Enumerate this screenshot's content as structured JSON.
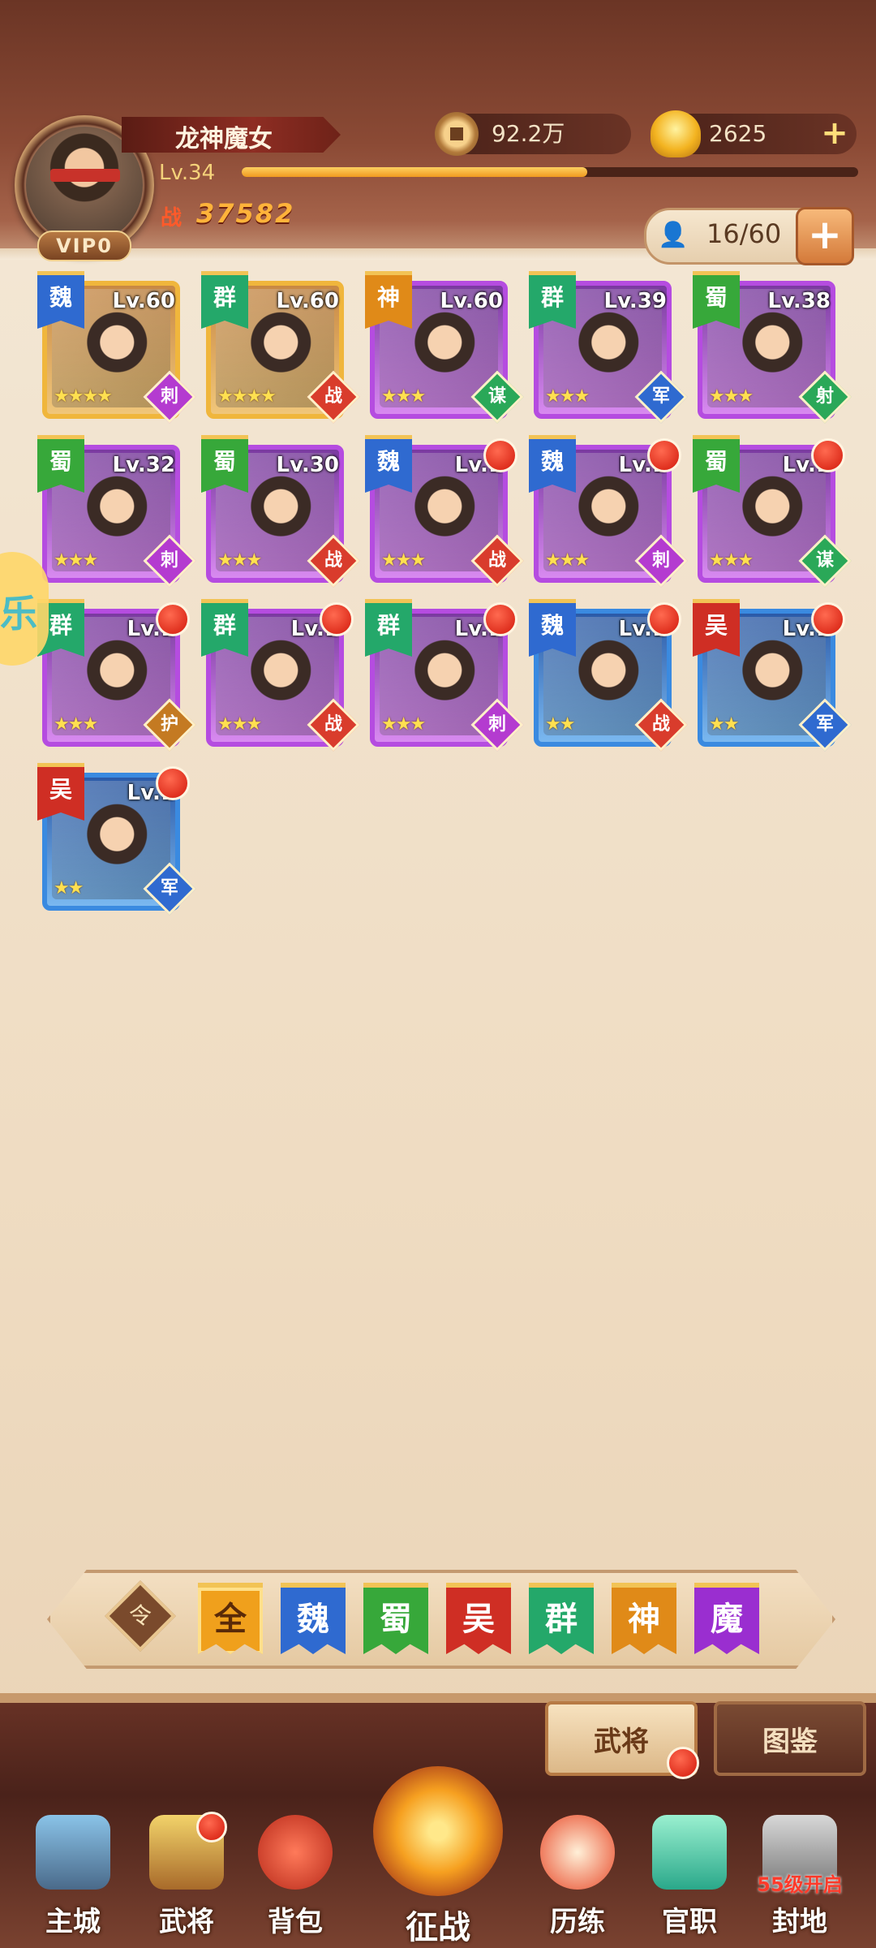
{
  "header": {
    "player_name": "龙神魔女",
    "level": "Lv.34",
    "xp_fraction": 0.56,
    "vip": "VIP0",
    "power": "37582",
    "power_icon": "战",
    "currency_coin": "92.2万",
    "currency_gold": "2625",
    "hero_capacity": "16/60"
  },
  "heroes": [
    {
      "faction": "魏",
      "level": "Lv.60",
      "stars": "★★★★",
      "role": "刺"
    },
    {
      "faction": "群",
      "level": "Lv.60",
      "stars": "★★★★",
      "role": "战"
    },
    {
      "faction": "神",
      "level": "Lv.60",
      "stars": "★★★",
      "role": "谋"
    },
    {
      "faction": "群",
      "level": "Lv.39",
      "stars": "★★★",
      "role": "军"
    },
    {
      "faction": "蜀",
      "level": "Lv.38",
      "stars": "★★★",
      "role": "射"
    },
    {
      "faction": "蜀",
      "level": "Lv.32",
      "stars": "★★★",
      "role": "刺"
    },
    {
      "faction": "蜀",
      "level": "Lv.30",
      "stars": "★★★",
      "role": "战"
    },
    {
      "faction": "魏",
      "level": "Lv.1",
      "stars": "★★★",
      "role": "战"
    },
    {
      "faction": "魏",
      "level": "Lv.1",
      "stars": "★★★",
      "role": "刺"
    },
    {
      "faction": "蜀",
      "level": "Lv.1",
      "stars": "★★★",
      "role": "谋"
    },
    {
      "faction": "群",
      "level": "Lv.1",
      "stars": "★★★",
      "role": "护"
    },
    {
      "faction": "群",
      "level": "Lv.1",
      "stars": "★★★",
      "role": "战"
    },
    {
      "faction": "群",
      "level": "Lv.1",
      "stars": "★★★",
      "role": "刺"
    },
    {
      "faction": "魏",
      "level": "Lv.1",
      "stars": "★★",
      "role": "战"
    },
    {
      "faction": "吴",
      "level": "Lv.1",
      "stars": "★★",
      "role": "军"
    },
    {
      "faction": "吴",
      "level": "Lv.1",
      "stars": "★★",
      "role": "军"
    }
  ],
  "side_bubble": "乐",
  "filter": {
    "toggle_icon": "令",
    "tabs": [
      "全",
      "魏",
      "蜀",
      "吴",
      "群",
      "神",
      "魔"
    ]
  },
  "subtabs": {
    "active": "武将",
    "other": "图鉴"
  },
  "nav": {
    "city": "主城",
    "heroes": "武将",
    "bag": "背包",
    "battle": "征战",
    "training": "历练",
    "office": "官职",
    "fief": "封地",
    "fief_lock": "55级开启"
  },
  "colors": {
    "accent": "#f09a20",
    "wei": "#2f6ad0",
    "shu": "#37a83a",
    "wu": "#cf2e24",
    "qun": "#24a86a",
    "shen": "#e08a18",
    "mo": "#9a2ed0"
  }
}
